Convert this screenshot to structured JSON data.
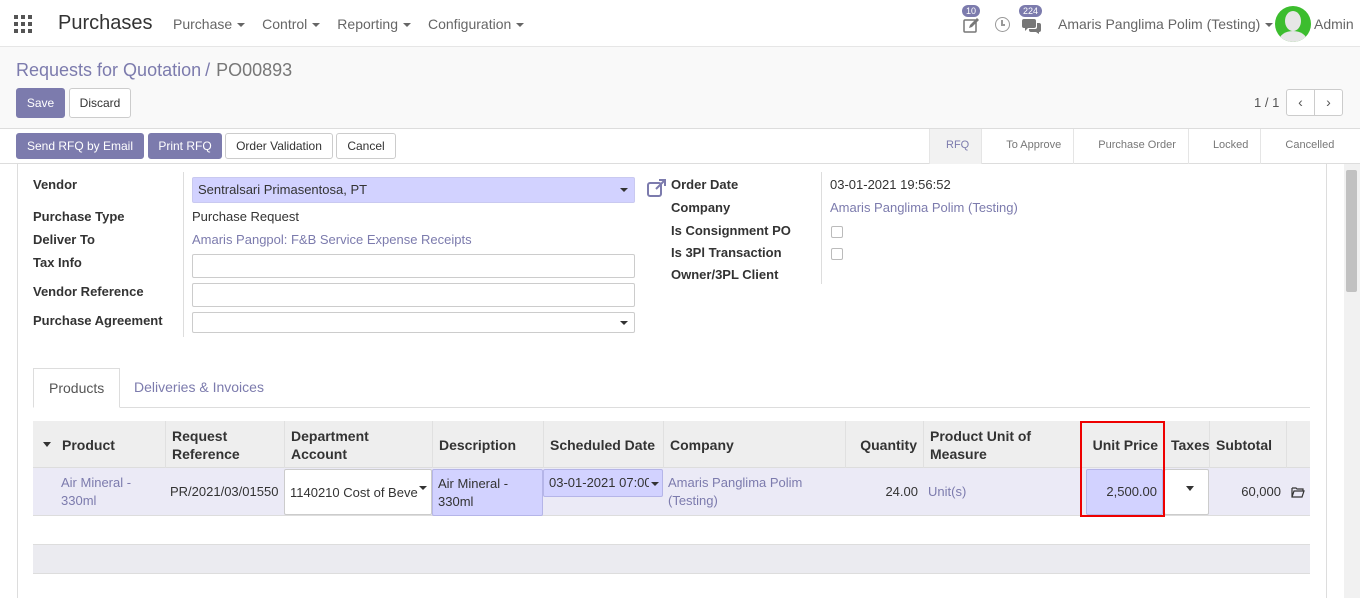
{
  "navbar": {
    "brand": "Purchases",
    "menus": [
      "Purchase",
      "Control",
      "Reporting",
      "Configuration"
    ],
    "activity_count": "10",
    "message_count": "224",
    "user": "Amaris Panglima Polim (Testing)",
    "admin": "Admin"
  },
  "control": {
    "breadcrumb_parent": "Requests for Quotation",
    "breadcrumb_sep": "/",
    "breadcrumb_current": "PO00893",
    "save": "Save",
    "discard": "Discard",
    "pager": "1 / 1"
  },
  "statusbar": {
    "buttons": [
      "Send RFQ by Email",
      "Print RFQ",
      "Order Validation",
      "Cancel"
    ],
    "stages": [
      "RFQ",
      "To Approve",
      "Purchase Order",
      "Locked",
      "Cancelled"
    ]
  },
  "form": {
    "vendor_label": "Vendor",
    "vendor_value": "Sentralsari Primasentosa, PT",
    "purchase_type_label": "Purchase Type",
    "purchase_type_value": "Purchase Request",
    "deliver_to_label": "Deliver To",
    "deliver_to_value": "Amaris Pangpol: F&B Service Expense Receipts",
    "tax_info_label": "Tax Info",
    "vendor_ref_label": "Vendor Reference",
    "purchase_agreement_label": "Purchase Agreement",
    "order_date_label": "Order Date",
    "order_date_value": "03-01-2021 19:56:52",
    "company_label": "Company",
    "company_value": "Amaris Panglima Polim (Testing)",
    "consignment_label": "Is Consignment PO",
    "tpl_label": "Is 3Pl Transaction",
    "owner_label": "Owner/3PL Client"
  },
  "tabs": [
    "Products",
    "Deliveries & Invoices"
  ],
  "table": {
    "headers": {
      "product": "Product",
      "request_ref": "Request Reference",
      "department": "Department Account",
      "description": "Description",
      "scheduled": "Scheduled Date",
      "company": "Company",
      "quantity": "Quantity",
      "uom": "Product Unit of Measure",
      "unit_price": "Unit Price",
      "taxes": "Taxes",
      "subtotal": "Subtotal"
    },
    "row": {
      "product": "Air Mineral - 330ml",
      "request_ref": "PR/2021/03/01550",
      "department": "1140210 Cost of Beve",
      "description": "Air Mineral - 330ml",
      "scheduled": "03-01-2021 07:00",
      "company": "Amaris Panglima Polim (Testing)",
      "quantity": "24.00",
      "uom": "Unit(s)",
      "unit_price": "2,500.00",
      "subtotal": "60,000"
    }
  },
  "colors": {
    "accent": "#7c7bad",
    "required": "#d2d2ff",
    "highlight": "#ee0000"
  }
}
